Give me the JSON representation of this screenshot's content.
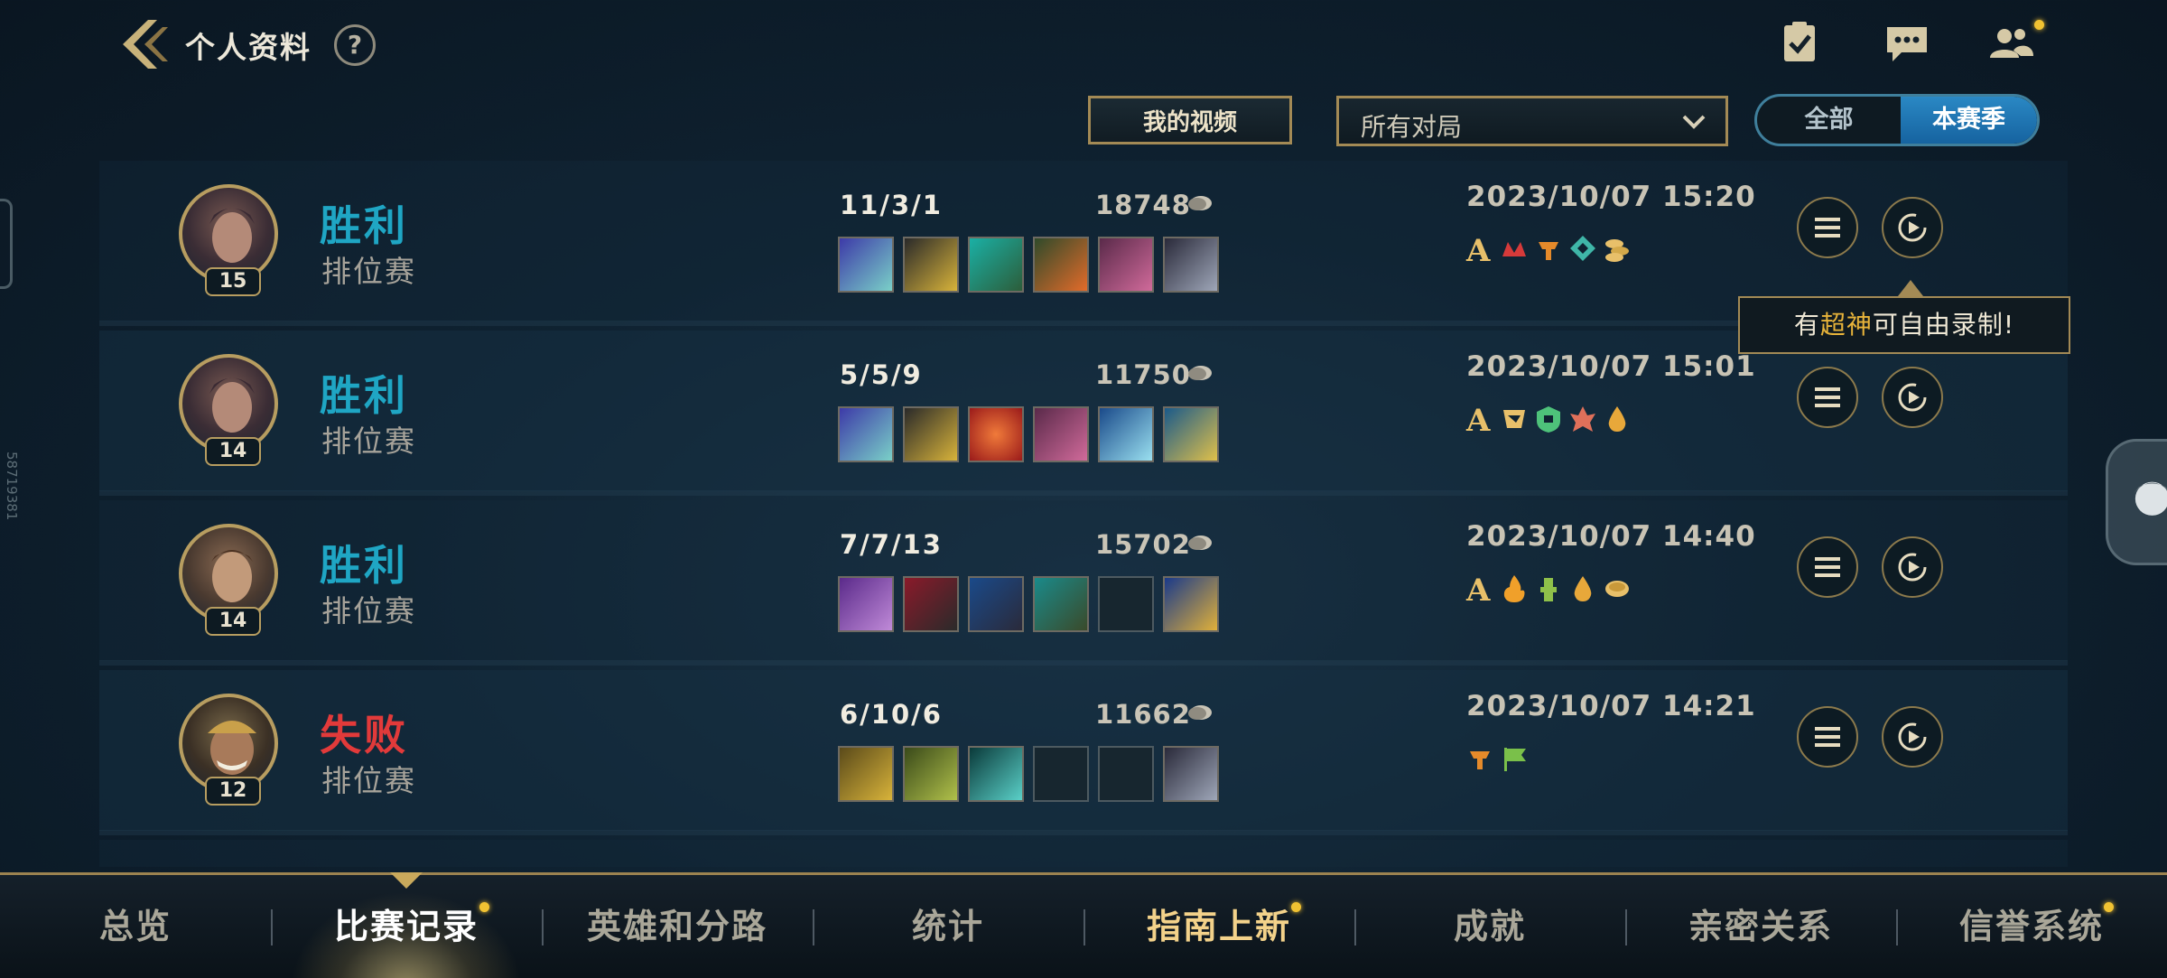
{
  "header": {
    "title": "个人资料",
    "help_label": "?"
  },
  "filters": {
    "video_button": "我的视频",
    "match_filter": "所有对局",
    "segment_all": "全部",
    "segment_season": "本赛季"
  },
  "matches": [
    {
      "level": "15",
      "result": "胜利",
      "mode": "排位赛",
      "kda": "11/3/1",
      "gold": "18748",
      "date": "2023/10/07 15:20",
      "outcome": "win"
    },
    {
      "level": "14",
      "result": "胜利",
      "mode": "排位赛",
      "kda": "5/5/9",
      "gold": "11750",
      "date": "2023/10/07 15:01",
      "outcome": "win"
    },
    {
      "level": "14",
      "result": "胜利",
      "mode": "排位赛",
      "kda": "7/7/13",
      "gold": "15702",
      "date": "2023/10/07 14:40",
      "outcome": "win"
    },
    {
      "level": "12",
      "result": "失败",
      "mode": "排位赛",
      "kda": "6/10/6",
      "gold": "11662",
      "date": "2023/10/07 14:21",
      "outcome": "lose"
    }
  ],
  "tooltip": {
    "prefix": "有",
    "highlight": "超神",
    "suffix": "可自由录制!"
  },
  "side_text": "58719381",
  "nav": {
    "items": [
      "总览",
      "比赛记录",
      "英雄和分路",
      "统计",
      "指南上新",
      "成就",
      "亲密关系",
      "信誉系统"
    ]
  },
  "colors": {
    "win": "#1fa6c4",
    "lose": "#e23a3a",
    "accent_gold": "#a38a55",
    "notification_dot": "#f1c232"
  },
  "icons": {
    "back": "back-chevron-icon",
    "tasks": "clipboard-check-icon",
    "chat": "chat-bubble-icon",
    "friends": "friends-icon",
    "gold": "gold-coin-icon",
    "detail": "list-icon",
    "replay": "replay-icon"
  }
}
